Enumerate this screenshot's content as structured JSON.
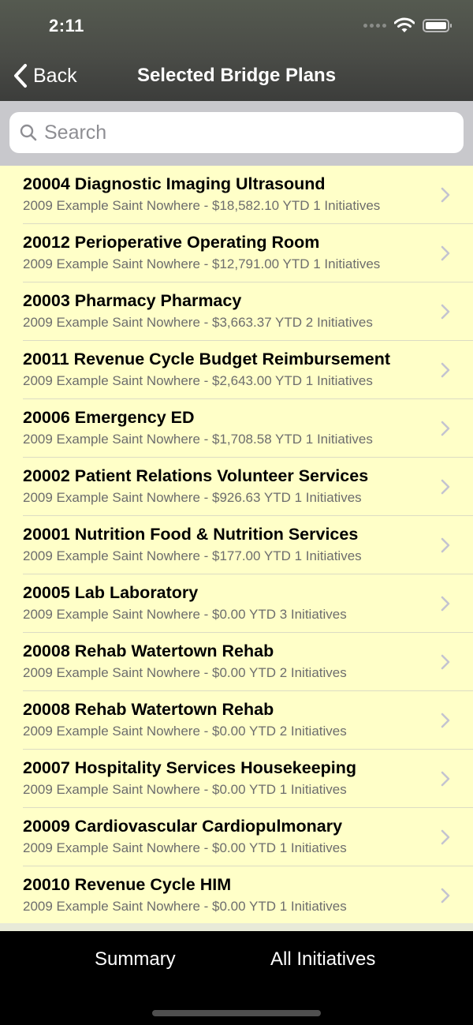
{
  "status_bar": {
    "time": "2:11"
  },
  "nav": {
    "back_label": "Back",
    "title": "Selected Bridge Plans"
  },
  "search": {
    "placeholder": "Search",
    "value": ""
  },
  "list": {
    "items": [
      {
        "title": "20004 Diagnostic Imaging Ultrasound",
        "subtitle": "2009 Example Saint Nowhere - $18,582.10 YTD 1 Initiatives"
      },
      {
        "title": "20012 Perioperative Operating Room",
        "subtitle": "2009 Example Saint Nowhere - $12,791.00 YTD 1 Initiatives"
      },
      {
        "title": "20003 Pharmacy Pharmacy",
        "subtitle": "2009 Example Saint Nowhere - $3,663.37 YTD 2 Initiatives"
      },
      {
        "title": "20011 Revenue Cycle Budget Reimbursement",
        "subtitle": "2009 Example Saint Nowhere - $2,643.00 YTD 1 Initiatives"
      },
      {
        "title": "20006 Emergency ED",
        "subtitle": "2009 Example Saint Nowhere - $1,708.58 YTD 1 Initiatives"
      },
      {
        "title": "20002 Patient Relations Volunteer Services",
        "subtitle": "2009 Example Saint Nowhere - $926.63 YTD 1 Initiatives"
      },
      {
        "title": "20001 Nutrition Food & Nutrition Services",
        "subtitle": "2009 Example Saint Nowhere - $177.00 YTD 1 Initiatives"
      },
      {
        "title": "20005 Lab Laboratory",
        "subtitle": "2009 Example Saint Nowhere - $0.00 YTD 3 Initiatives"
      },
      {
        "title": "20008 Rehab Watertown Rehab",
        "subtitle": "2009 Example Saint Nowhere - $0.00 YTD 2 Initiatives"
      },
      {
        "title": "20008 Rehab Watertown Rehab",
        "subtitle": "2009 Example Saint Nowhere - $0.00 YTD 2 Initiatives"
      },
      {
        "title": "20007 Hospitality Services Housekeeping",
        "subtitle": "2009 Example Saint Nowhere - $0.00 YTD 1 Initiatives"
      },
      {
        "title": "20009 Cardiovascular Cardiopulmonary",
        "subtitle": "2009 Example Saint Nowhere - $0.00 YTD 1 Initiatives"
      },
      {
        "title": "20010 Revenue Cycle HIM",
        "subtitle": "2009 Example Saint Nowhere - $0.00 YTD 1 Initiatives"
      }
    ]
  },
  "tabbar": {
    "summary_label": "Summary",
    "all_initiatives_label": "All Initiatives"
  },
  "colors": {
    "list_background": "#ffffc8",
    "header_background": "#4a4c47",
    "tabbar_background": "#000000"
  }
}
